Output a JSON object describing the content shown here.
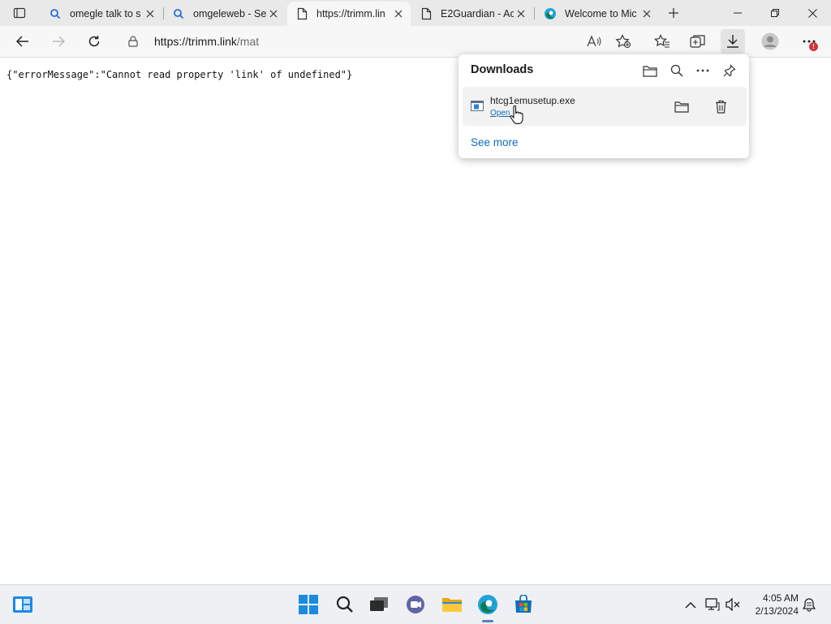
{
  "browser": {
    "tabs": [
      {
        "title": "omegle talk to s",
        "icon": "search-icon",
        "active": false
      },
      {
        "title": "omgeleweb - Se",
        "icon": "search-icon",
        "active": false
      },
      {
        "title": "https://trimm.lin",
        "icon": "page-icon",
        "active": true
      },
      {
        "title": "E2Guardian - Ac",
        "icon": "page-icon",
        "active": false
      },
      {
        "title": "Welcome to Mic",
        "icon": "edge-icon",
        "active": false
      }
    ],
    "address": {
      "host": "https://trimm.link",
      "path": "/mat"
    },
    "notification_badge": "!"
  },
  "page": {
    "body_text": "{\"errorMessage\":\"Cannot read property 'link' of undefined\"}"
  },
  "downloads": {
    "title": "Downloads",
    "items": [
      {
        "filename": "htcg1emusetup.exe",
        "action": "Open"
      }
    ],
    "see_more": "See more"
  },
  "taskbar": {
    "time": "4:05 AM",
    "date": "2/13/2024"
  },
  "colors": {
    "link": "#0f6cbd",
    "tabbar": "#e9e9e9",
    "taskbar": "#eef0f4"
  }
}
